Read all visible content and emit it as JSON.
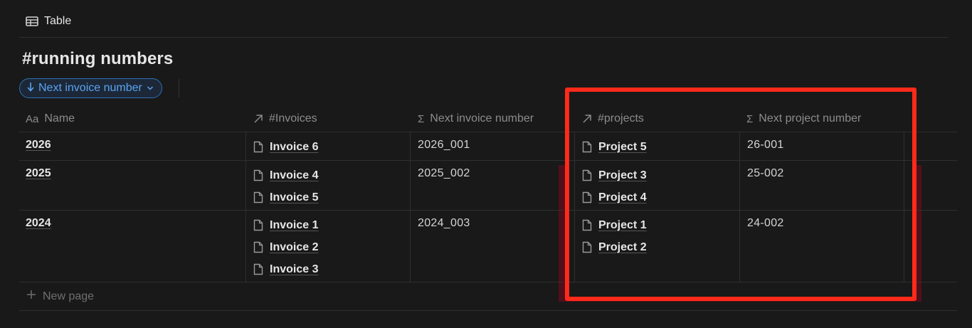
{
  "view": {
    "tab_label": "Table",
    "tab_icon": "table-icon"
  },
  "database": {
    "title": "#running numbers"
  },
  "sort": {
    "label": "Next invoice number",
    "direction_icon": "arrow-down-icon",
    "chevron_icon": "chevron-down-icon"
  },
  "columns": [
    {
      "label": "Name",
      "icon": "text-property-icon",
      "icon_text": "Aa"
    },
    {
      "label": "#Invoices",
      "icon": "relation-arrow-icon"
    },
    {
      "label": "Next invoice number",
      "icon": "formula-sigma-icon"
    },
    {
      "label": "#projects",
      "icon": "relation-arrow-icon"
    },
    {
      "label": "Next project number",
      "icon": "formula-sigma-icon"
    }
  ],
  "rows": [
    {
      "name": "2026",
      "invoices": [
        "Invoice 6"
      ],
      "next_invoice": "2026_001",
      "projects": [
        "Project 5"
      ],
      "next_project": "26-001"
    },
    {
      "name": "2025",
      "invoices": [
        "Invoice 4",
        "Invoice 5"
      ],
      "next_invoice": "2025_002",
      "projects": [
        "Project 3",
        "Project 4"
      ],
      "next_project": "25-002"
    },
    {
      "name": "2024",
      "invoices": [
        "Invoice 1",
        "Invoice 2",
        "Invoice 3"
      ],
      "next_invoice": "2024_003",
      "projects": [
        "Project 1",
        "Project 2"
      ],
      "next_project": "24-002"
    }
  ],
  "new_page": {
    "label": "New page",
    "icon": "plus-icon"
  },
  "colors": {
    "highlight_border": "#ff2a1a",
    "accent_blue": "#5aa3f0",
    "background": "#191919"
  }
}
